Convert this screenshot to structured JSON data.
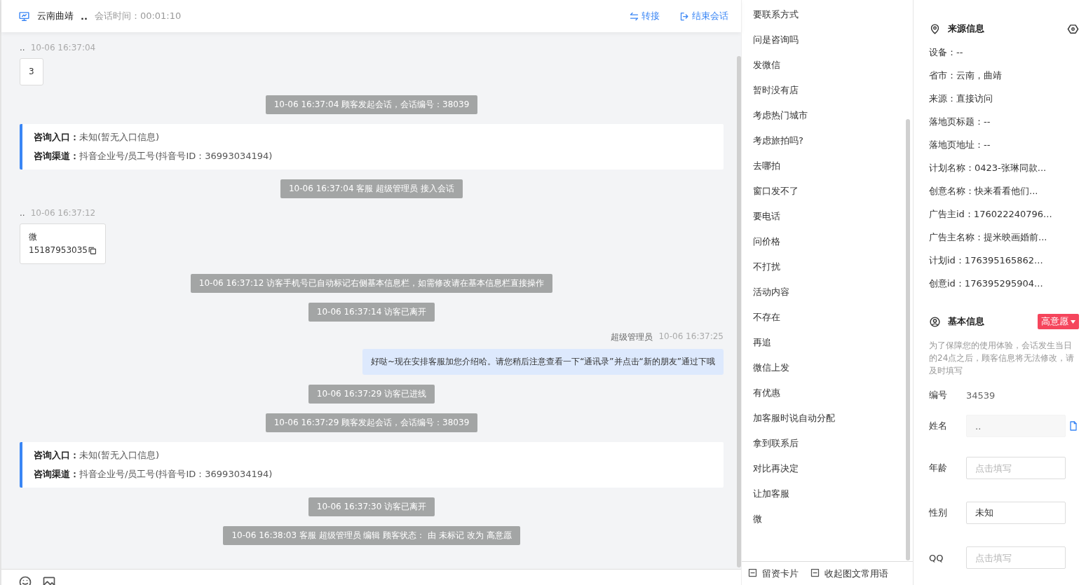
{
  "header": {
    "title": "云南曲靖",
    "visitor": "..",
    "duration_label": "会话时间：",
    "duration": "00:01:10",
    "actions": [
      {
        "kind": "transfer",
        "label": "转接"
      },
      {
        "kind": "end",
        "label": "结束会话"
      }
    ]
  },
  "messages": [
    {
      "kind": "visitor",
      "name": "..",
      "time": "10-06 16:37:04",
      "lines": [
        "3"
      ],
      "copy": false
    },
    {
      "kind": "system",
      "text": "10-06 16:37:04 顾客发起会话，会话编号：38039"
    },
    {
      "kind": "info",
      "rows": [
        {
          "label": "咨询入口：",
          "value": "未知(暂无入口信息)"
        },
        {
          "label": "咨询渠道：",
          "value": "抖音企业号/员工号(抖音号ID：36993034194)"
        }
      ]
    },
    {
      "kind": "system",
      "text": "10-06 16:37:04 客服 超级管理员 接入会话"
    },
    {
      "kind": "visitor",
      "name": "..",
      "time": "10-06 16:37:12",
      "lines": [
        "微",
        "15187953035"
      ],
      "copy": true
    },
    {
      "kind": "system",
      "text": "10-06 16:37:12 访客手机号已自动标记右侧基本信息栏，如需修改请在基本信息栏直接操作"
    },
    {
      "kind": "system",
      "text": "10-06 16:37:14 访客已离开"
    },
    {
      "kind": "agent",
      "name": "超级管理员",
      "time": "10-06 16:37:25",
      "lines": [
        "好哒~现在安排客服加您介绍哈。请您稍后注意查看一下“通讯录”并点击“新的朋友”通过下哦"
      ]
    },
    {
      "kind": "system",
      "text": "10-06 16:37:29 访客已进线"
    },
    {
      "kind": "system",
      "text": "10-06 16:37:29 顾客发起会话，会话编号：38039"
    },
    {
      "kind": "info",
      "rows": [
        {
          "label": "咨询入口：",
          "value": "未知(暂无入口信息)"
        },
        {
          "label": "咨询渠道：",
          "value": "抖音企业号/员工号(抖音号ID：36993034194)"
        }
      ]
    },
    {
      "kind": "system",
      "text": "10-06 16:37:30 访客已离开"
    },
    {
      "kind": "system",
      "text": "10-06 16:38:03 客服 超级管理员 编辑 顾客状态： 由 未标记 改为 高意愿"
    }
  ],
  "quick_replies": [
    "要联系方式",
    "问是咨询吗",
    "发微信",
    "暂时没有店",
    "考虑热门城市",
    "考虑旅拍吗?",
    "去哪拍",
    "窗口发不了",
    "要电话",
    "问价格",
    "不打扰",
    "活动内容",
    "不存在",
    "再追",
    "微信上发",
    "有优惠",
    "加客服时说自动分配",
    "拿到联系后",
    "对比再决定",
    "让加客服",
    "微"
  ],
  "quick_footer": [
    {
      "label": "留资卡片"
    },
    {
      "label": "收起图文常用语"
    }
  ],
  "source_info": {
    "title": "来源信息",
    "rows": [
      "设备：--",
      "省市：云南，曲靖",
      "来源：直接访问",
      "落地页标题：--",
      "落地页地址：--",
      "计划名称：0423-张琳同款...",
      "创意名称：快来看看他们...",
      "广告主id：176022240796...",
      "广告主名称：提米映画婚前...",
      "计划id：176395165862...",
      "创意id：176395295904..."
    ]
  },
  "basic_info": {
    "title": "基本信息",
    "tag": {
      "label": "高意愿",
      "color": "#f5455c"
    },
    "notice": "为了保障您的使用体验，会话发生当日的24点之后，顾客信息将无法修改，请及时填写",
    "fields": [
      {
        "kind": "text",
        "label": "编号",
        "value": "34539"
      },
      {
        "kind": "readonly",
        "label": "姓名",
        "value": ".."
      },
      {
        "kind": "input",
        "label": "年龄",
        "placeholder": "点击填写"
      },
      {
        "kind": "input",
        "label": "性别",
        "value": "未知"
      },
      {
        "kind": "input",
        "label": "QQ",
        "placeholder": "点击填写"
      }
    ]
  }
}
